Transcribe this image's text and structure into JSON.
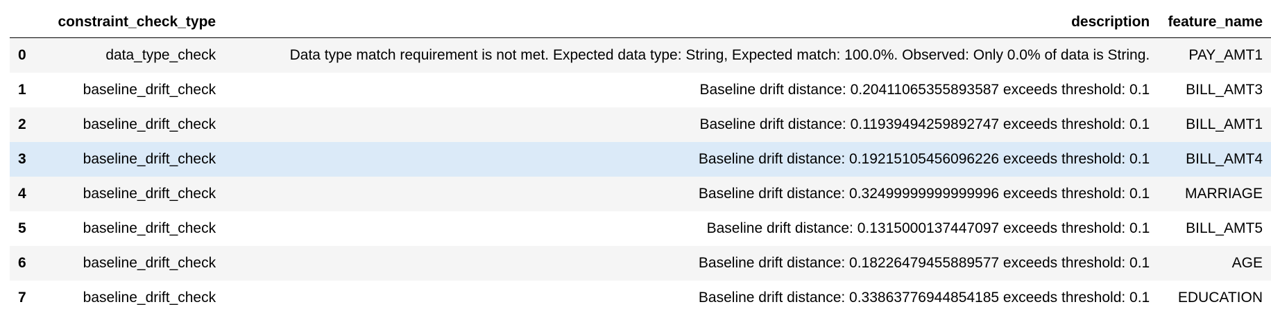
{
  "table": {
    "columns": [
      "",
      "constraint_check_type",
      "description",
      "feature_name"
    ],
    "hovered_row": 3,
    "rows": [
      {
        "index": "0",
        "constraint_check_type": "data_type_check",
        "description": "Data type match requirement is not met. Expected data type: String, Expected match: 100.0%. Observed: Only 0.0% of data is String.",
        "feature_name": "PAY_AMT1"
      },
      {
        "index": "1",
        "constraint_check_type": "baseline_drift_check",
        "description": "Baseline drift distance: 0.20411065355893587 exceeds threshold: 0.1",
        "feature_name": "BILL_AMT3"
      },
      {
        "index": "2",
        "constraint_check_type": "baseline_drift_check",
        "description": "Baseline drift distance: 0.11939494259892747 exceeds threshold: 0.1",
        "feature_name": "BILL_AMT1"
      },
      {
        "index": "3",
        "constraint_check_type": "baseline_drift_check",
        "description": "Baseline drift distance: 0.19215105456096226 exceeds threshold: 0.1",
        "feature_name": "BILL_AMT4"
      },
      {
        "index": "4",
        "constraint_check_type": "baseline_drift_check",
        "description": "Baseline drift distance: 0.32499999999999996 exceeds threshold: 0.1",
        "feature_name": "MARRIAGE"
      },
      {
        "index": "5",
        "constraint_check_type": "baseline_drift_check",
        "description": "Baseline drift distance: 0.1315000137447097 exceeds threshold: 0.1",
        "feature_name": "BILL_AMT5"
      },
      {
        "index": "6",
        "constraint_check_type": "baseline_drift_check",
        "description": "Baseline drift distance: 0.18226479455889577 exceeds threshold: 0.1",
        "feature_name": "AGE"
      },
      {
        "index": "7",
        "constraint_check_type": "baseline_drift_check",
        "description": "Baseline drift distance: 0.33863776944854185 exceeds threshold: 0.1",
        "feature_name": "EDUCATION"
      }
    ]
  },
  "colors": {
    "stripe": "#f5f5f5",
    "hover": "#dbeaf8",
    "header_rule": "#000000"
  }
}
